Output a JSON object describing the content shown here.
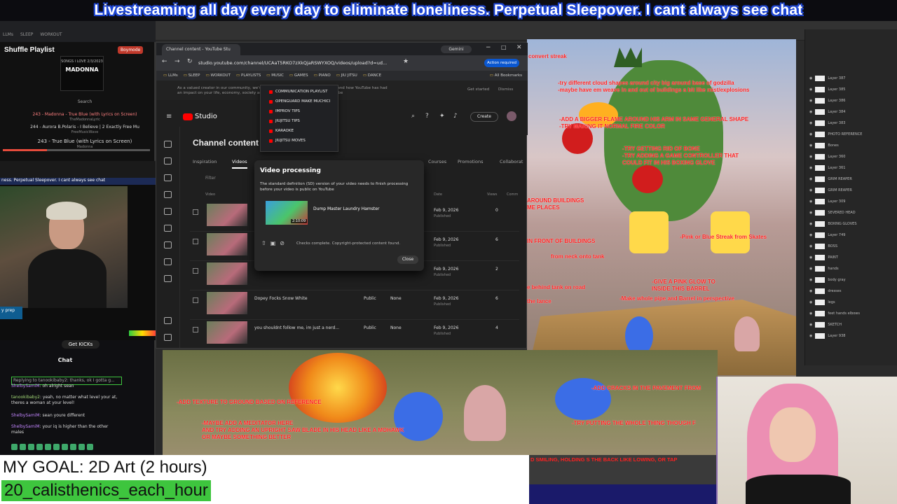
{
  "banner": "Livestreaming all day every day to eliminate loneliness. Perpetual Sleepover. I cant always see chat",
  "music": {
    "title": "Shuffle Playlist",
    "badge": "Boymode",
    "cover_heading": "SONGS I LOVE 2/3/2023",
    "cover_artist": "MADONNA",
    "search_label": "Search",
    "tracks": [
      "243 - Madonna - True Blue (with Lyrics on Screen)",
      "244 - Aurora B.Polaris - I Believe | 2 Exactly Free Mu",
      "243 - True Blue (with Lyrics on Screen)"
    ],
    "track_subs": [
      "TheMadonnaLyric",
      "FreeMusicWave",
      "Madonna"
    ],
    "progress": 0.3
  },
  "cam_left": {
    "caption": "ness. Perpetual Sleepover. I cant always see chat",
    "prep_label": "y prep"
  },
  "chat": {
    "kicks_label": "Get KICKs",
    "title": "Chat",
    "messages": [
      {
        "user": "ShelbySamiM",
        "text": "oh alright sean"
      },
      {
        "user": "tanookibaby2",
        "text": "yeah, no matter what level your at, theres a woman at your level!"
      },
      {
        "user": "ShelbySamiM",
        "text": "sean youre different"
      },
      {
        "user": "ShelbySamiM",
        "text": "your iq is higher than the other males"
      }
    ],
    "reply_context": "Replying to tanookibaby2: thanks, ok I gotta g..."
  },
  "goal": {
    "line1": "MY GOAL: 2D Art (2 hours)",
    "line2": "20_calisthenics_each_hour"
  },
  "browser": {
    "tab_title": "Channel content - YouTube Stu",
    "gemini_label": "Gemini",
    "url": "studio.youtube.com/channel/UCAaT5RKO7zXkQjaRSWYXOQ/videos/upload?d=ud...",
    "action_label": "Action required",
    "bookmarks": [
      "LLMs",
      "SLEEP",
      "WORKOUT",
      "PLAYLISTS",
      "MUSIC",
      "GAMES",
      "PIANO",
      "JIU JITSU",
      "DANCE"
    ],
    "all_bookmarks": "All Bookmarks",
    "notice": "As a valued creator in our community, we'd love to hear from you. Help us understand how YouTube has had an impact on your life, economy, society and culture. Please help us reshape YouTube",
    "get_started": "Get started",
    "dismiss": "Dismiss"
  },
  "dropdown": {
    "items": [
      "COMMUNICATION PLAYLIST",
      "OPENGUARD MAKE MUCHICI",
      "IMPROV TIPS",
      "JIUJITSU TIPS",
      "KARAOKE",
      "JIUJITSU MOVES"
    ]
  },
  "studio": {
    "logo": "Studio",
    "create": "Create",
    "channel_title": "Channel content",
    "tabs": [
      "Inspiration",
      "Videos",
      "Courses",
      "Promotions",
      "Collaborat"
    ],
    "filter": "Filter",
    "columns": {
      "video": "Video",
      "date": "Date",
      "views": "Views",
      "comments": "Comm"
    },
    "rows": [
      {
        "title": "",
        "visibility": "",
        "restrictions": "",
        "date": "Feb 9, 2026",
        "status": "Published",
        "views": "0"
      },
      {
        "title": "",
        "visibility": "",
        "restrictions": "",
        "date": "Feb 9, 2026",
        "status": "Published",
        "views": "6"
      },
      {
        "title": "",
        "visibility": "",
        "restrictions": "",
        "date": "Feb 9, 2026",
        "status": "Published",
        "views": "2"
      },
      {
        "title": "Dopey Focks Snow White",
        "visibility": "Public",
        "restrictions": "None",
        "date": "Feb 9, 2026",
        "status": "Published",
        "views": "6"
      },
      {
        "title": "you shouldnt follow me, im just a nerd...",
        "visibility": "Public",
        "restrictions": "None",
        "date": "Feb 9, 2026",
        "status": "Published",
        "views": "4"
      }
    ]
  },
  "dialog": {
    "title": "Video processing",
    "message": "The standard definition (SD) version of your video needs to finish processing before your video is public on YouTube",
    "video_title": "Dump Master Laundry Hamster",
    "duration": "2:10:09",
    "checks": "Checks complete. Copyright-protected content found.",
    "close": "Close"
  },
  "art_notes": [
    "convert streak",
    "-try different cloud shapes around city big around base of godzilla",
    "-maybe have em weave in and out of buildings a bit like mist/explosions",
    "-ADD A BIGGER FLAME AROUND HIS ARM IN SAME GENERAL SHAPE",
    "-TRY MAKING IT NORMAL FIRE COLOR",
    "-TRY GETTING RID OF BONE",
    "-TRY ADDING A GAME CONTROLLER THAT",
    "COULD FIT IN HIS BOXING GLOVE",
    "AROUND BUILDINGS",
    "ME PLACES",
    "IN FRONT OF BUILDINGS",
    "-Pink or Blue Streak from Skates",
    "from neck onto tank",
    "-GIVE A PINK GLOW TO",
    "INSIDE THIS BARREL",
    "-Make whole pipe and Barrel in perspective",
    "e behind tank on road",
    "the lance",
    "-ADD TEXTURE TO GROUND BASED ON REFERENCE",
    "-MAYBE ADD A MEDITATOR HERE",
    "AND TRY ADDING AN UPRIGHT SAW BLADE IN HIS HEAD LIKE A MOHAWK",
    "OR MAYBE SOMETHING BETTER",
    "-ADD CRACKS IN THE PAVEMENT FROM",
    "-TRY PUTTING THE WHOLE THING THOUGH F",
    "D SMILING, HOLDING S THE BACK LIKE LOWING, OR TAP"
  ],
  "layers": [
    "Layer 387",
    "Layer 385",
    "Layer 386",
    "Layer 384",
    "Layer 383",
    "PHOTO REFERENCE",
    "Bones",
    "Layer 360",
    "Layer 361",
    "GRIM REAPER",
    "GRIM REAPER",
    "Layer 309",
    "SEVERED HEAD",
    "BOXING GLOVES",
    "Layer 749",
    "BOSS",
    "PAINT",
    "hands",
    "body gray",
    "dresses",
    "legs",
    "feet hands elbows",
    "SKETCH",
    "Layer 938"
  ],
  "colors": {
    "banner_outline": "#1d46d6",
    "goal_highlight": "#3ec53e",
    "annotation_red": "#ff2020",
    "yt_red": "#ff0000",
    "action_blue": "#0b57d0"
  }
}
